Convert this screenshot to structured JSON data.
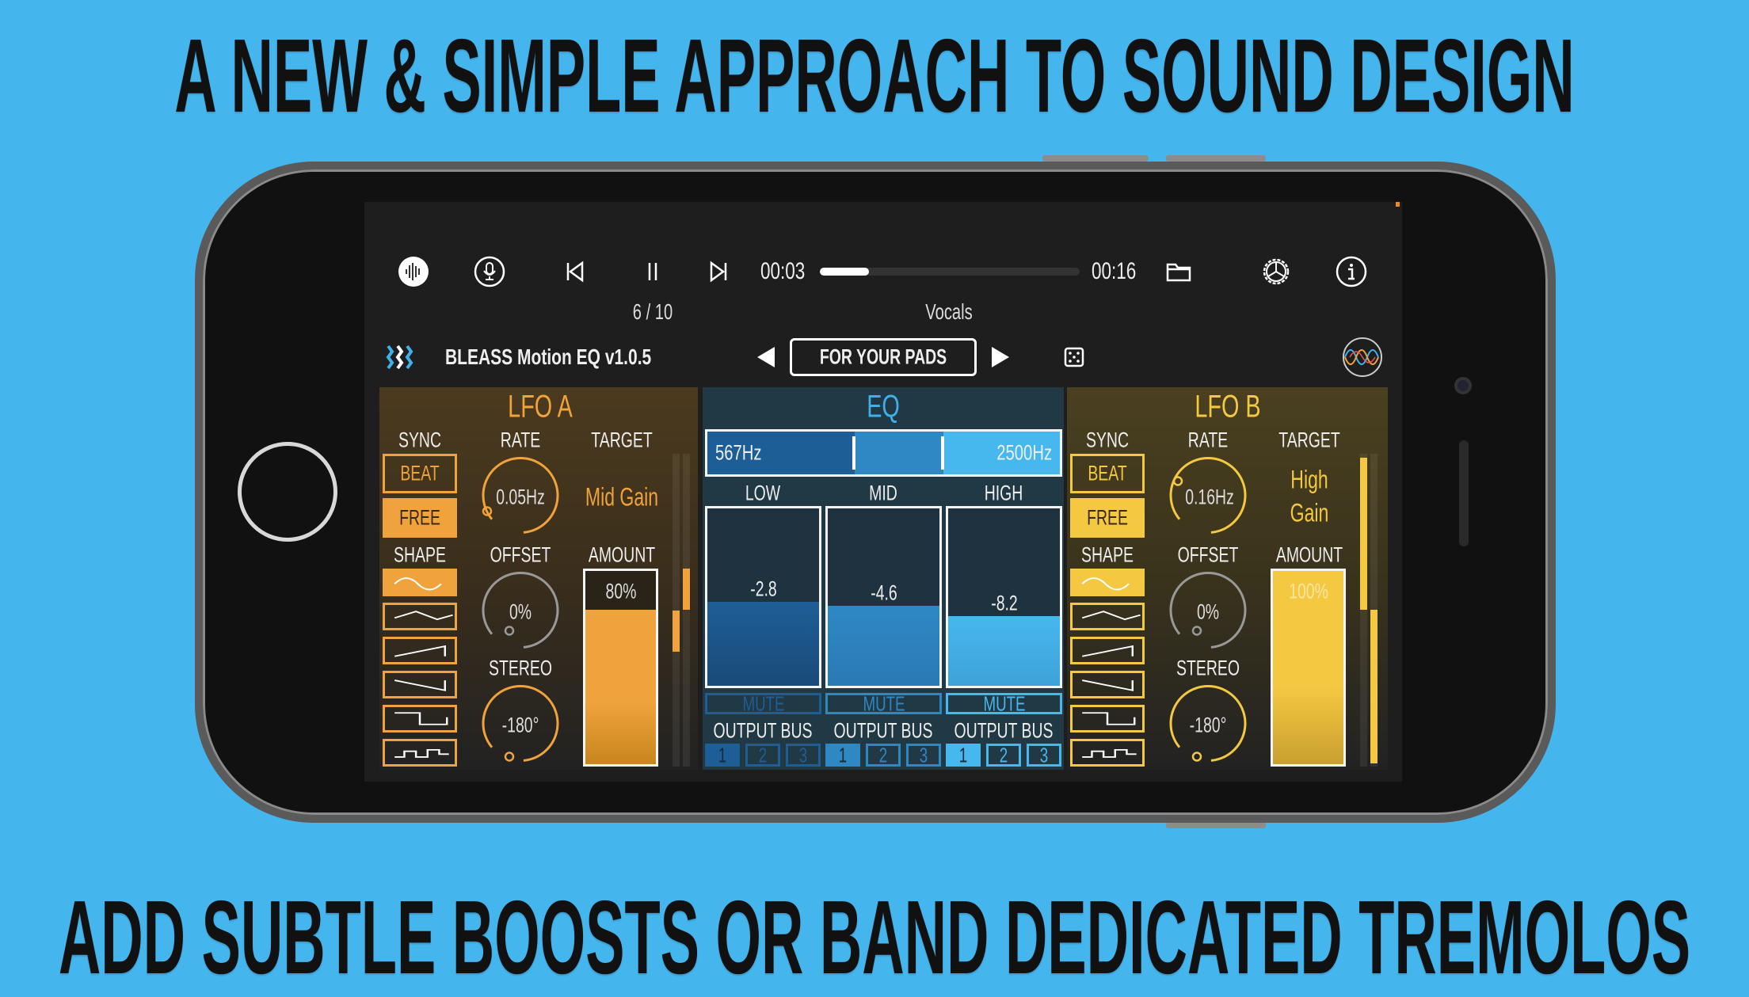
{
  "headline_top": "A NEW & SIMPLE APPROACH TO SOUND DESIGN",
  "headline_bottom": "ADD SUBTLE BOOSTS OR BAND DEDICATED TREMOLOS",
  "colors": {
    "background": "#45b5ee",
    "lfo_a": "#f0a33c",
    "lfo_b": "#f5c842",
    "eq_title": "#3fb0ea",
    "eq_low": "#1e5e96",
    "eq_mid": "#2e88c4",
    "eq_high": "#46b8ee"
  },
  "transport": {
    "time_current": "00:03",
    "time_total": "00:16",
    "progress": 0.19,
    "track_index": "6 / 10",
    "track_name": "Vocals",
    "icons": [
      "waveform-icon",
      "microphone-icon",
      "skip-back-icon",
      "pause-icon",
      "skip-forward-icon",
      "folder-icon",
      "gear-icon",
      "info-icon"
    ]
  },
  "plugin": {
    "name": "BLEASS Motion EQ v1.0.5",
    "preset": "FOR YOUR PADS"
  },
  "lfo_a": {
    "title": "LFO A",
    "sync_label": "SYNC",
    "beat": "BEAT",
    "free": "FREE",
    "sync_selected": "FREE",
    "rate_label": "RATE",
    "rate": "0.05Hz",
    "target_label": "TARGET",
    "target": "Mid Gain",
    "shape_label": "SHAPE",
    "shape_selected": "sine",
    "offset_label": "OFFSET",
    "offset": "0%",
    "stereo_label": "STEREO",
    "stereo": "-180°",
    "amount_label": "AMOUNT",
    "amount": "80%",
    "amount_value": 80
  },
  "lfo_b": {
    "title": "LFO B",
    "sync_label": "SYNC",
    "beat": "BEAT",
    "free": "FREE",
    "sync_selected": "FREE",
    "rate_label": "RATE",
    "rate": "0.16Hz",
    "target_label": "TARGET",
    "target_line1": "High",
    "target_line2": "Gain",
    "shape_label": "SHAPE",
    "shape_selected": "sine",
    "offset_label": "OFFSET",
    "offset": "0%",
    "stereo_label": "STEREO",
    "stereo": "-180°",
    "amount_label": "AMOUNT",
    "amount": "100%",
    "amount_value": 100
  },
  "eq": {
    "title": "EQ",
    "low_freq": "567Hz",
    "high_freq": "2500Hz",
    "bands": [
      {
        "label": "LOW",
        "gain": "-2.8",
        "mute": "MUTE",
        "output_label": "OUTPUT BUS",
        "bus_selected": 1
      },
      {
        "label": "MID",
        "gain": "-4.6",
        "mute": "MUTE",
        "output_label": "OUTPUT BUS",
        "bus_selected": 1
      },
      {
        "label": "HIGH",
        "gain": "-8.2",
        "mute": "MUTE",
        "output_label": "OUTPUT BUS",
        "bus_selected": 1
      }
    ],
    "bus_options": [
      "1",
      "2",
      "3"
    ]
  }
}
